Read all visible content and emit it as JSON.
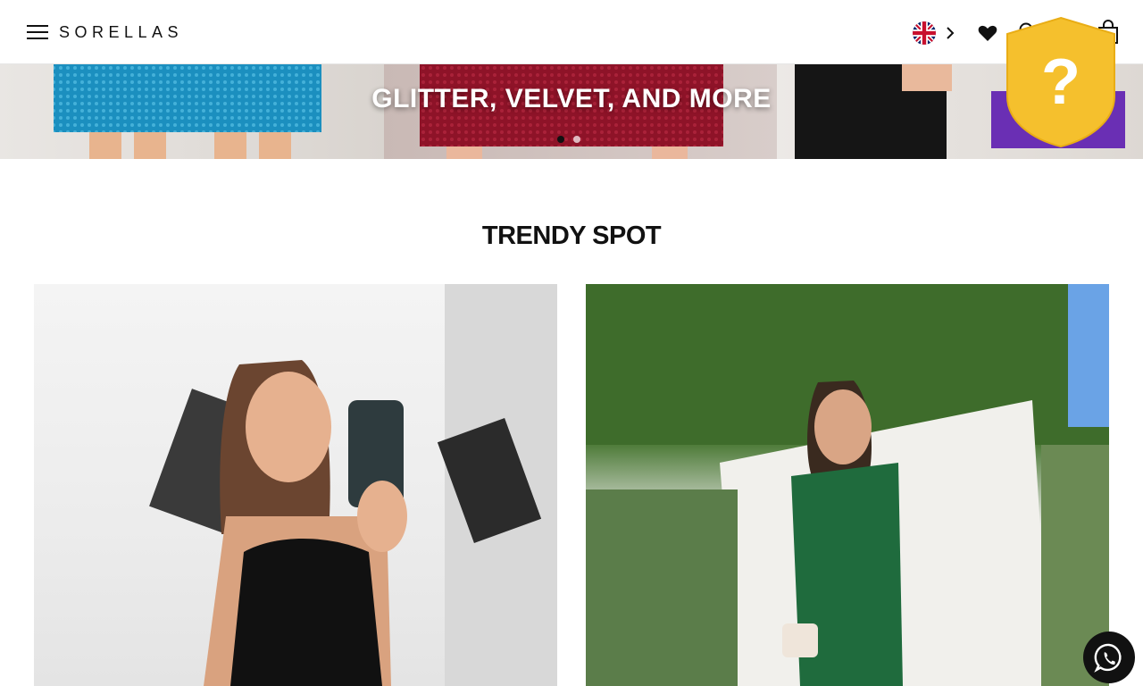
{
  "header": {
    "brand": "SORELLAS",
    "menu_icon": "hamburger-menu-icon",
    "language_icon": "uk-flag-icon",
    "icons": [
      "chevron-right-icon",
      "heart-icon",
      "search-icon",
      "shopping-bag-icon"
    ]
  },
  "hero": {
    "caption": "GLITTER, VELVET, AND MORE",
    "slides": 2,
    "active_slide": 1
  },
  "section": {
    "title": "TRENDY SPOT",
    "cards": [
      {
        "image": "woman in black sequin cut-out dress taking mirror selfie"
      },
      {
        "image": "woman in green satin one-shoulder dress outdoors"
      }
    ]
  },
  "help_badge": {
    "symbol": "?",
    "color": "#f5c02d"
  },
  "whatsapp": {
    "icon": "whatsapp-icon"
  }
}
